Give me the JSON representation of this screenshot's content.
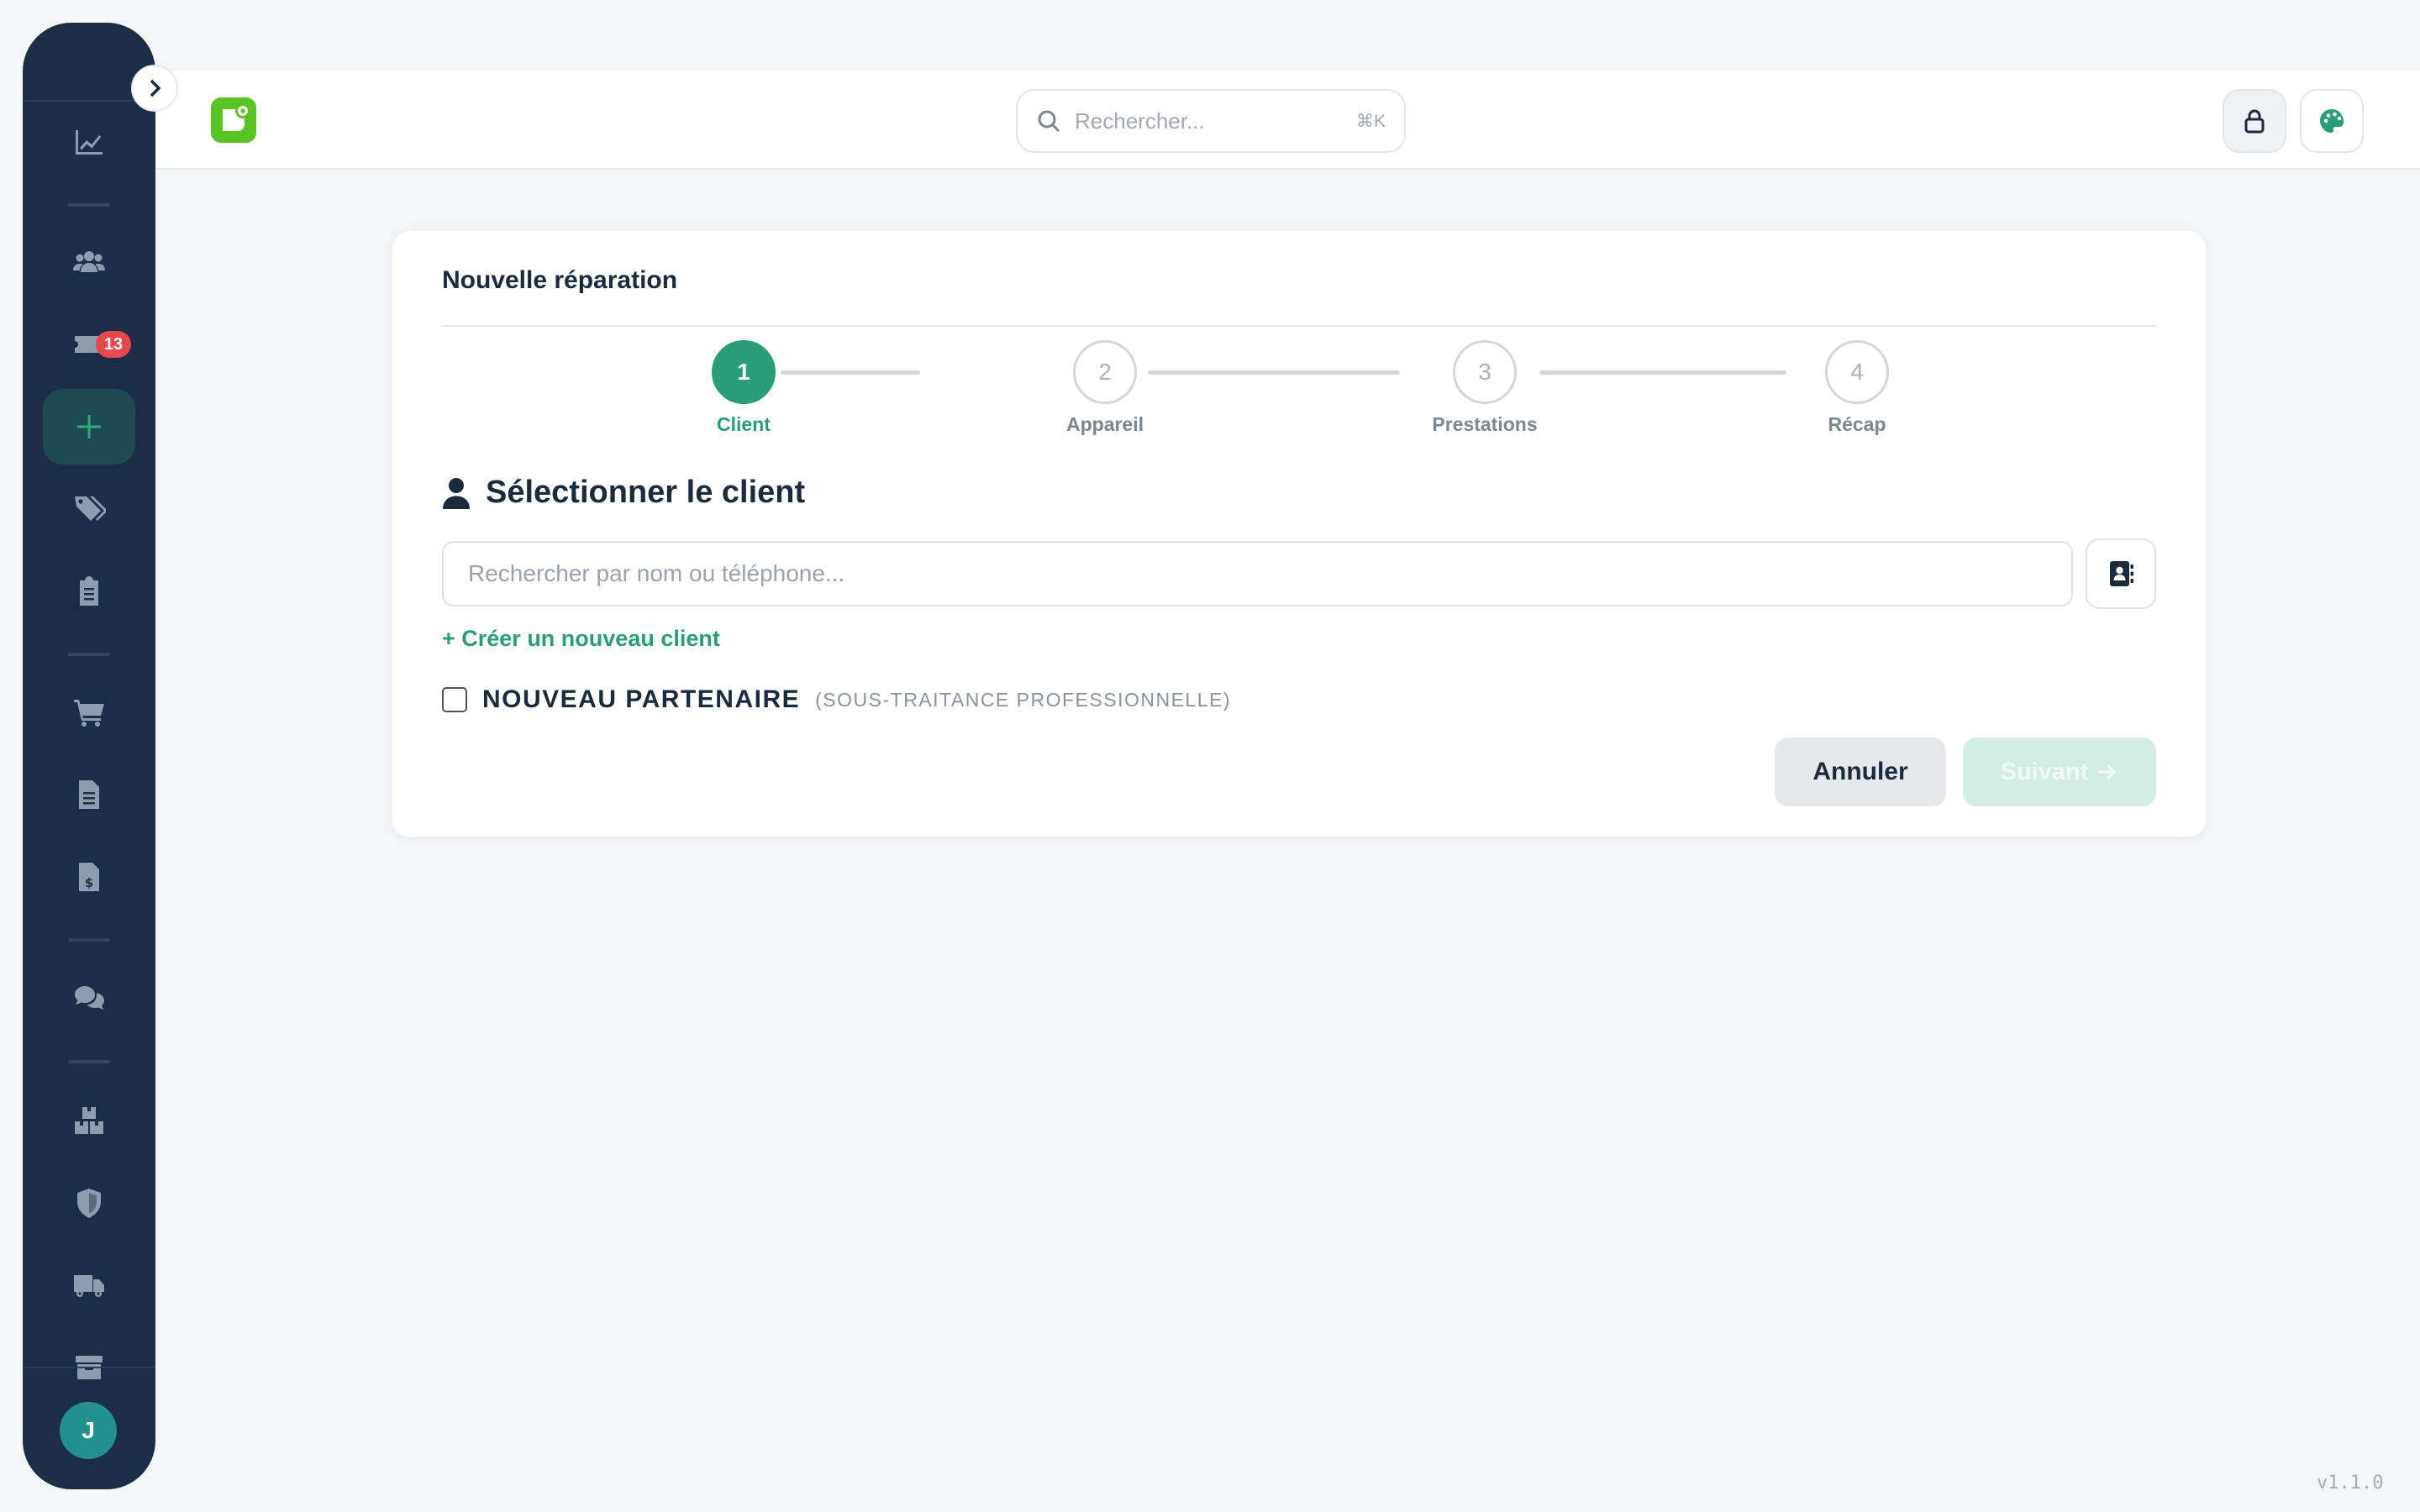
{
  "colors": {
    "sidebar_bg": "#1b2e45",
    "accent": "#2a9d78",
    "badge": "#e5484d",
    "logo": "#58c322"
  },
  "sidebar": {
    "items": [
      {
        "icon": "chart-line-icon"
      },
      {
        "icon": "users-icon"
      },
      {
        "icon": "ticket-icon",
        "badge": "13"
      },
      {
        "icon": "plus-icon",
        "active": true
      },
      {
        "icon": "tags-icon"
      },
      {
        "icon": "clipboard-list-icon"
      },
      {
        "icon": "shopping-cart-icon"
      },
      {
        "icon": "file-lines-icon"
      },
      {
        "icon": "file-invoice-dollar-icon"
      },
      {
        "icon": "comments-icon"
      },
      {
        "icon": "boxes-icon"
      },
      {
        "icon": "shield-icon"
      },
      {
        "icon": "truck-icon"
      },
      {
        "icon": "archive-icon"
      }
    ],
    "avatar_initial": "J"
  },
  "header": {
    "search_placeholder": "Rechercher...",
    "search_shortcut": "⌘K"
  },
  "card": {
    "title": "Nouvelle réparation",
    "steps": [
      {
        "number": "1",
        "label": "Client",
        "active": true
      },
      {
        "number": "2",
        "label": "Appareil"
      },
      {
        "number": "3",
        "label": "Prestations"
      },
      {
        "number": "4",
        "label": "Récap"
      }
    ],
    "section_title": "Sélectionner le client",
    "client_search_placeholder": "Rechercher par nom ou téléphone...",
    "create_client_link": "+ Créer un nouveau client",
    "partner_checkbox_label": "NOUVEAU PARTENAIRE",
    "partner_checkbox_sublabel": "(SOUS-TRAITANCE PROFESSIONNELLE)",
    "cancel_label": "Annuler",
    "next_label": "Suivant"
  },
  "version": "v1.1.0"
}
